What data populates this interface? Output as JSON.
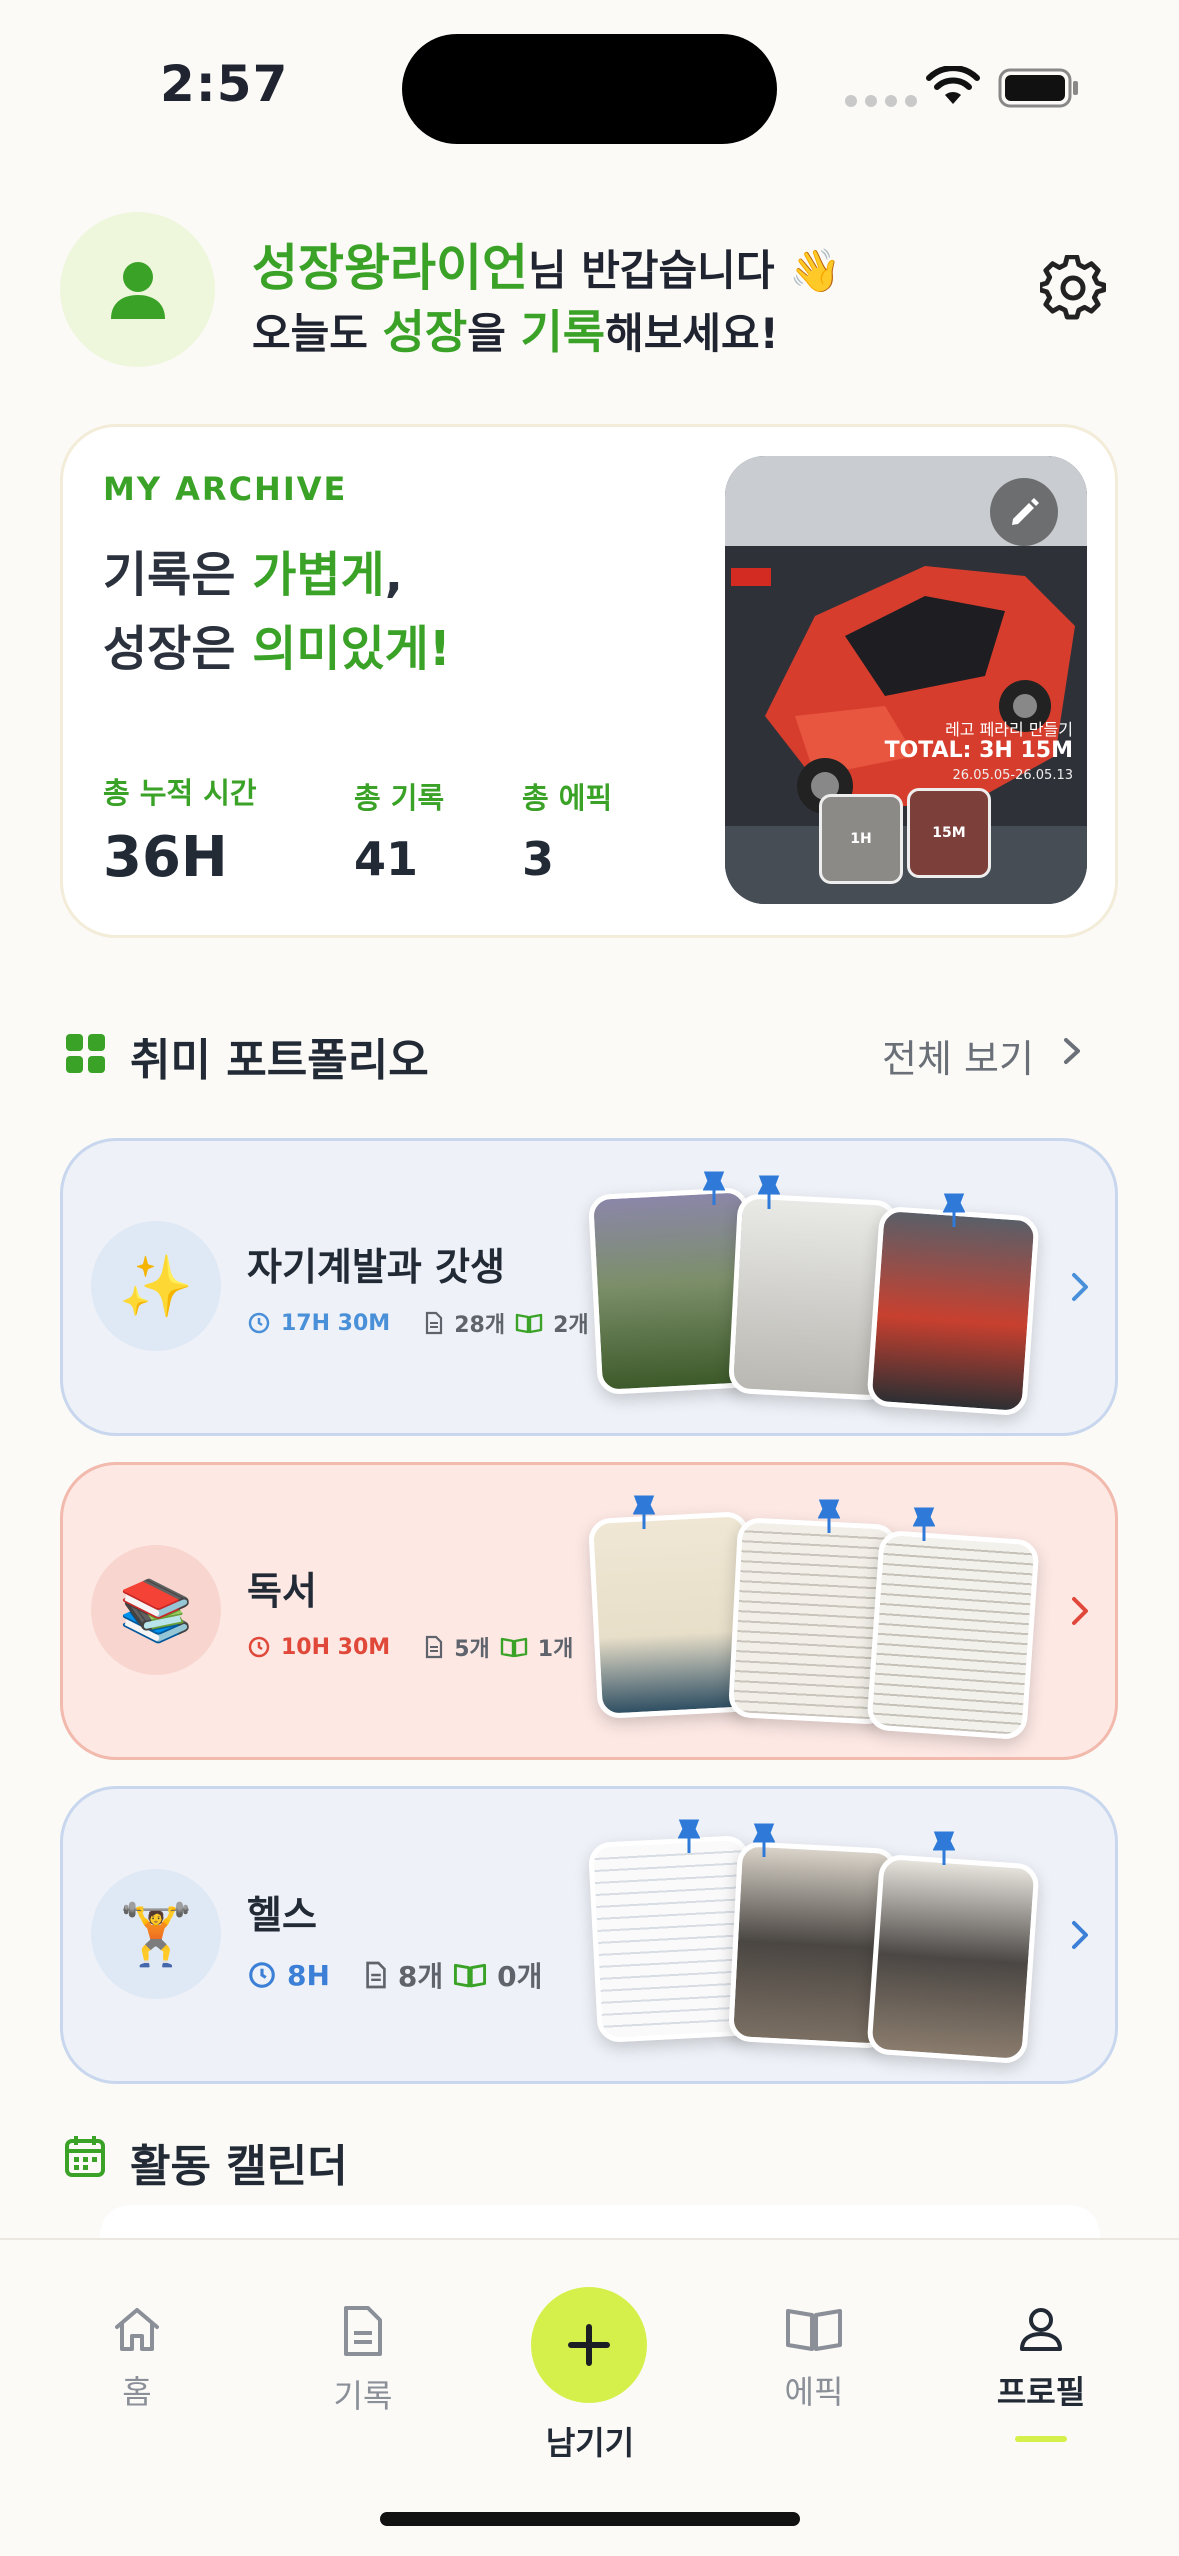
{
  "status_bar": {
    "time": "2:57"
  },
  "header": {
    "nickname": "성장왕라이언",
    "greeting_suffix": "님 반갑습니다 👋",
    "line2_a": "오늘도 ",
    "line2_b": "성장",
    "line2_c": "을 ",
    "line2_d": "기록",
    "line2_e": "해보세요!"
  },
  "archive": {
    "label": "MY ARCHIVE",
    "title_a": "기록은 ",
    "title_b": "가볍게",
    "title_c": ",",
    "title_d": "성장은 ",
    "title_e": "의미있게!",
    "stats": [
      {
        "label": "총 누적 시간",
        "value": "36H"
      },
      {
        "label": "총 기록",
        "value": "41"
      },
      {
        "label": "총 에픽",
        "value": "3"
      }
    ],
    "photo": {
      "subtitle": "레고 페라리 만들기",
      "total": "TOTAL: 3H 15M",
      "range": "26.05.05-26.05.13",
      "thumb1": "1H",
      "thumb2": "15M"
    }
  },
  "portfolio": {
    "title": "취미 포트폴리오",
    "see_all": "전체 보기",
    "cards": [
      {
        "name": "자기계발과 갓생",
        "emoji": "✨",
        "time": "17H 30M",
        "records": "28개",
        "epics": "2개",
        "theme": "blue",
        "time_color": "#4a90d9"
      },
      {
        "name": "독서",
        "emoji": "📚",
        "time": "10H 30M",
        "records": "5개",
        "epics": "1개",
        "theme": "red",
        "time_color": "#e0483a"
      },
      {
        "name": "헬스",
        "emoji": "🏋️",
        "time": "8H",
        "records": "8개",
        "epics": "0개",
        "theme": "blue",
        "time_color": "#3c7fd6"
      }
    ]
  },
  "calendar": {
    "title": "활동 캘린더"
  },
  "tabbar": {
    "home": "홈",
    "records": "기록",
    "add": "남기기",
    "epic": "에픽",
    "profile": "프로필"
  },
  "colors": {
    "accent_green": "#3aa227",
    "lime": "#d6f04b",
    "blue": "#4a90d9",
    "red": "#e0483a"
  }
}
